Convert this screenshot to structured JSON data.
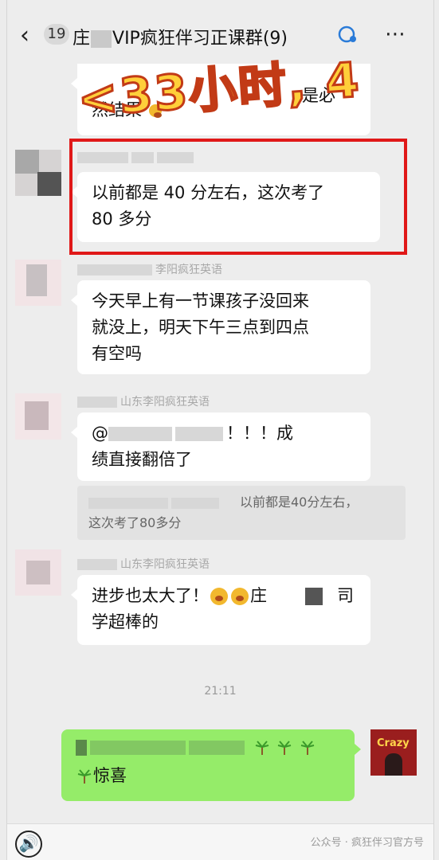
{
  "header": {
    "back_icon": "chevron-left-icon",
    "unread_count": "19",
    "title_prefix": "庄",
    "title_suffix": "VIP疯狂伴习正课群(9)",
    "more_icon": "more-dots-icon"
  },
  "banner": {
    "text": "<33小时, 4"
  },
  "messages": [
    {
      "partial_text_line1": "然结果",
      "partial_tail": "是必"
    },
    {
      "text_line1": "以前都是 40 分左右，这次考了",
      "text_line2": "80 多分"
    },
    {
      "name_tail": "李阳疯狂英语",
      "text_line1": "今天早上有一节课孩子没回来",
      "text_line2": "就没上，明天下午三点到四点",
      "text_line3": "有空吗"
    },
    {
      "name": "山东李阳疯狂英语",
      "text_line1": "@",
      "text_line1_tail": "！！！成",
      "text_line2": "绩直接翻倍了",
      "quote_line1": "以前都是40分左右，",
      "quote_line2": "这次考了80多分"
    },
    {
      "name": "山东李阳疯狂英语",
      "text_line1_a": "进步也太大了！",
      "text_line1_b": "庄",
      "text_line1_c": "司",
      "text_line2": "学超棒的"
    },
    {
      "time": "21:11"
    },
    {
      "green_line2": "惊喜",
      "avatar_label": "Crazy"
    }
  ],
  "bottom": {
    "voice_icon": "voice-icon",
    "emoji_icon": "emoji-icon",
    "plus_icon": "plus-icon",
    "watermark": "公众号 · 疯狂伴习官方号"
  }
}
